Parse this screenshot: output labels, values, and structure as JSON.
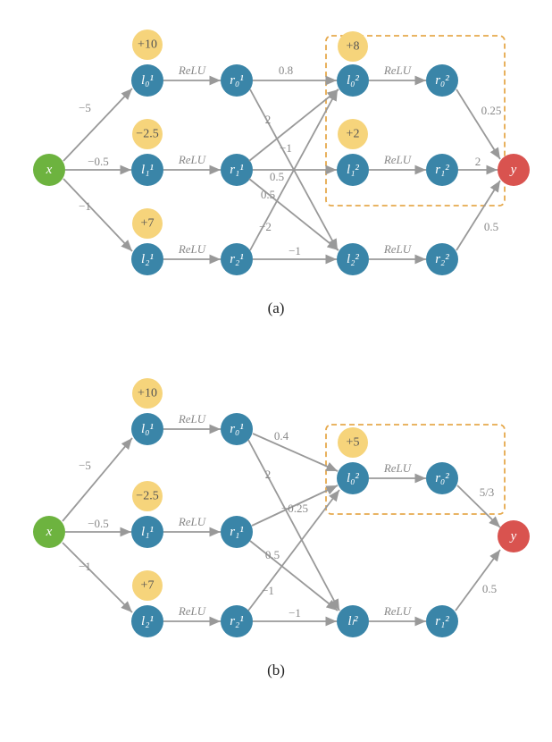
{
  "figureA": {
    "label": "(a)",
    "input": {
      "name": "x"
    },
    "output": {
      "name": "y"
    },
    "layer1": {
      "l0": {
        "name": "l₀¹",
        "bias": "+10"
      },
      "l1": {
        "name": "l₁¹",
        "bias": "−2.5"
      },
      "l2": {
        "name": "l₂¹",
        "bias": "+7"
      },
      "r0": {
        "name": "r₀¹"
      },
      "r1": {
        "name": "r₁¹"
      },
      "r2": {
        "name": "r₂¹"
      }
    },
    "layer2": {
      "l0": {
        "name": "l₀²",
        "bias": "+8"
      },
      "l1": {
        "name": "l₁²",
        "bias": "+2"
      },
      "l2": {
        "name": "l₂²"
      },
      "r0": {
        "name": "r₀²"
      },
      "r1": {
        "name": "r₁²"
      },
      "r2": {
        "name": "r₂²"
      }
    },
    "weights": {
      "x_l0": "−5",
      "x_l1": "−0.5",
      "x_l2": "−1",
      "r0_l20": "0.8",
      "r0_l22": "2",
      "r1_l20": "−1",
      "r1_l21": "0.5",
      "r1_l22": "0.5",
      "r2_l20": "−2",
      "r2_l22": "−1",
      "r20_y": "0.25",
      "r21_y": "2",
      "r22_y": "0.5"
    },
    "relu": "ReLU"
  },
  "figureB": {
    "label": "(b)",
    "input": {
      "name": "x"
    },
    "output": {
      "name": "y"
    },
    "layer1": {
      "l0": {
        "name": "l₀¹",
        "bias": "+10"
      },
      "l1": {
        "name": "l₁¹",
        "bias": "−2.5"
      },
      "l2": {
        "name": "l₂¹",
        "bias": "+7"
      },
      "r0": {
        "name": "r₀¹"
      },
      "r1": {
        "name": "r₁¹"
      },
      "r2": {
        "name": "r₂¹"
      }
    },
    "layer2": {
      "l0": {
        "name": "l₀²",
        "bias": "+5"
      },
      "ll": {
        "name": "lₗ²"
      },
      "r0": {
        "name": "r₀²"
      },
      "r1": {
        "name": "r₁²"
      }
    },
    "weights": {
      "x_l0": "−5",
      "x_l1": "−0.5",
      "x_l2": "−1",
      "r0_l20": "0.4",
      "r0_ll": "2",
      "r1_l20": "−0.25",
      "r1_ll": "0.5",
      "r2_l20": "−1",
      "r2_ll": "−1",
      "r20_y": "5/3",
      "r21_y": "0.5"
    },
    "relu": "ReLU"
  }
}
